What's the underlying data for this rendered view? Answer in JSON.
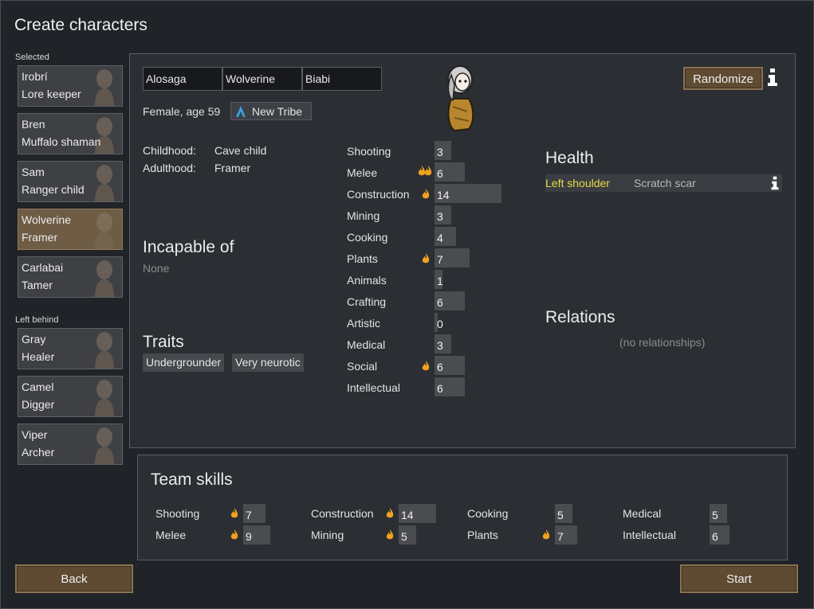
{
  "title": "Create characters",
  "selected_label": "Selected",
  "left_behind_label": "Left behind",
  "selected_pawns": [
    {
      "name": "Irobrí",
      "role": "Lore keeper"
    },
    {
      "name": "Bren",
      "role": "Muffalo shaman"
    },
    {
      "name": "Sam",
      "role": "Ranger child"
    },
    {
      "name": "Wolverine",
      "role": "Framer"
    },
    {
      "name": "Carlabai",
      "role": "Tamer"
    }
  ],
  "left_behind_pawns": [
    {
      "name": "Gray",
      "role": "Healer"
    },
    {
      "name": "Camel",
      "role": "Digger"
    },
    {
      "name": "Viper",
      "role": "Archer"
    }
  ],
  "pawn": {
    "first_name": "Alosaga",
    "nick_name": "Wolverine",
    "last_name": "Biabi",
    "description": "Female, age 59",
    "faction": "New Tribe",
    "childhood_label": "Childhood:",
    "childhood": "Cave child",
    "adulthood_label": "Adulthood:",
    "adulthood": "Framer",
    "incapable_heading": "Incapable of",
    "incapable_value": "None",
    "traits_heading": "Traits",
    "traits": [
      "Undergrounder",
      "Very neurotic"
    ]
  },
  "randomize_label": "Randomize",
  "skills": [
    {
      "name": "Shooting",
      "value": "3",
      "passion": 0
    },
    {
      "name": "Melee",
      "value": "6",
      "passion": 2
    },
    {
      "name": "Construction",
      "value": "14",
      "passion": 1
    },
    {
      "name": "Mining",
      "value": "3",
      "passion": 0
    },
    {
      "name": "Cooking",
      "value": "4",
      "passion": 0
    },
    {
      "name": "Plants",
      "value": "7",
      "passion": 1
    },
    {
      "name": "Animals",
      "value": "1",
      "passion": 0
    },
    {
      "name": "Crafting",
      "value": "6",
      "passion": 0
    },
    {
      "name": "Artistic",
      "value": "0",
      "passion": 0
    },
    {
      "name": "Medical",
      "value": "3",
      "passion": 0
    },
    {
      "name": "Social",
      "value": "6",
      "passion": 1
    },
    {
      "name": "Intellectual",
      "value": "6",
      "passion": 0
    }
  ],
  "health": {
    "heading": "Health",
    "part": "Left shoulder",
    "condition": "Scratch scar"
  },
  "relations": {
    "heading": "Relations",
    "empty": "(no relationships)"
  },
  "team_skills": {
    "heading": "Team skills",
    "items": [
      {
        "name": "Shooting",
        "value": "7",
        "passion": 1
      },
      {
        "name": "Melee",
        "value": "9",
        "passion": 1
      },
      {
        "name": "Construction",
        "value": "14",
        "passion": 1
      },
      {
        "name": "Mining",
        "value": "5",
        "passion": 1
      },
      {
        "name": "Cooking",
        "value": "5",
        "passion": 0
      },
      {
        "name": "Plants",
        "value": "7",
        "passion": 1
      },
      {
        "name": "Medical",
        "value": "5",
        "passion": 0
      },
      {
        "name": "Intellectual",
        "value": "6",
        "passion": 0
      }
    ]
  },
  "back_label": "Back",
  "start_label": "Start",
  "colors": {
    "accent_gold": "#5e4b32",
    "health_part": "#e6d94a",
    "flame": "#f0a020"
  }
}
